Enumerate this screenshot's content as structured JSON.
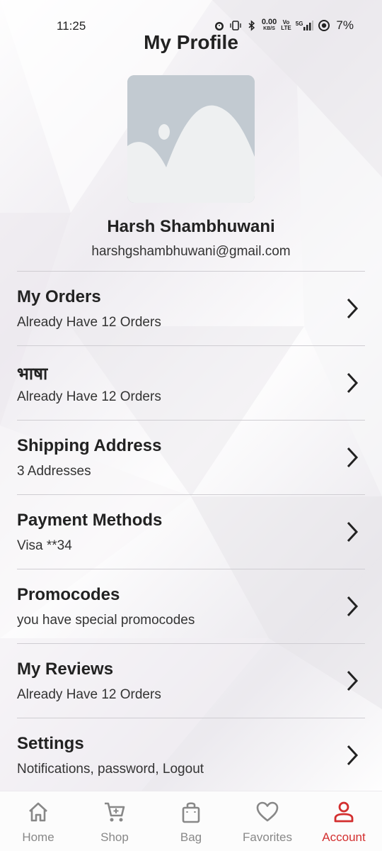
{
  "status_bar": {
    "time": "11:25",
    "net_speed": "0.00",
    "net_unit": "KB/S",
    "volte": "Vo",
    "lte": "LTE",
    "network": "5G",
    "battery": "7%"
  },
  "header": {
    "title": "My Profile"
  },
  "profile": {
    "name": "Harsh Shambhuwani",
    "email": "harshgshambhuwani@gmail.com"
  },
  "menu": {
    "items": [
      {
        "title": "My Orders",
        "subtitle": "Already Have 12 Orders"
      },
      {
        "title": "भाषा",
        "subtitle": "Already Have 12 Orders"
      },
      {
        "title": "Shipping Address",
        "subtitle": "3 Addresses"
      },
      {
        "title": "Payment Methods",
        "subtitle": "Visa **34"
      },
      {
        "title": "Promocodes",
        "subtitle": "you have special promocodes"
      },
      {
        "title": "My Reviews",
        "subtitle": "Already Have 12 Orders"
      },
      {
        "title": "Settings",
        "subtitle": "Notifications, password, Logout"
      }
    ]
  },
  "bottom_nav": {
    "items": [
      {
        "label": "Home",
        "icon": "home-icon"
      },
      {
        "label": "Shop",
        "icon": "cart-icon"
      },
      {
        "label": "Bag",
        "icon": "bag-icon"
      },
      {
        "label": "Favorites",
        "icon": "heart-icon"
      },
      {
        "label": "Account",
        "icon": "person-icon"
      }
    ],
    "active": "Account",
    "active_color": "#d32f2f",
    "inactive_color": "#888888"
  }
}
